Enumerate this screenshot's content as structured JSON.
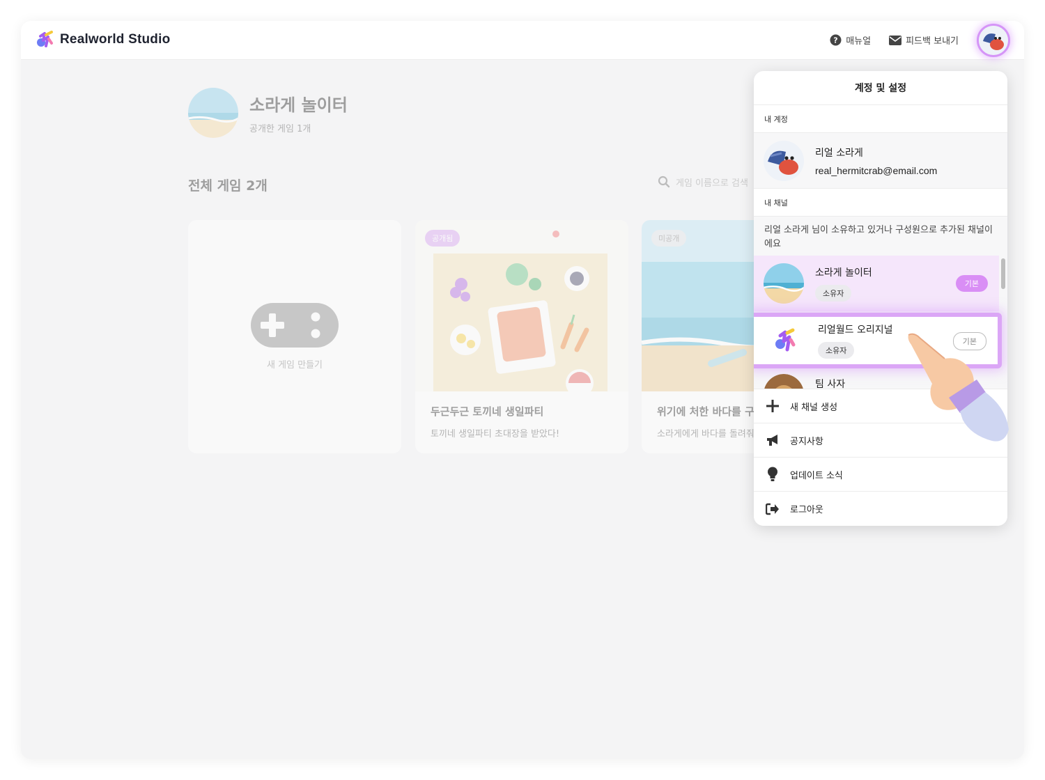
{
  "app": {
    "name": "Realworld Studio"
  },
  "topbar": {
    "manual_label": "매뉴얼",
    "feedback_label": "피드백 보내기"
  },
  "channel": {
    "name": "소라게 놀이터",
    "public_count": "공개한 게임 1개"
  },
  "games_section": {
    "title": "전체 게임 2개",
    "search_placeholder": "게임 이름으로 검색"
  },
  "cards": {
    "new_game_label": "새 게임 만들기",
    "items": [
      {
        "badge": "공개됨",
        "title": "두근두근 토끼네 생일파티",
        "desc": "토끼네 생일파티 초대장을 받았다!"
      },
      {
        "badge": "미공개",
        "title": "위기에 처한 바다를 구해줘",
        "desc": "소라게에게 바다를 돌려줘"
      }
    ]
  },
  "dropdown": {
    "title": "계정 및 설정",
    "my_account_label": "내 계정",
    "account": {
      "name": "리얼 소라게",
      "email": "real_hermitcrab@email.com"
    },
    "my_channels_label": "내 채널",
    "channels_notice": "리얼 소라게 님이 소유하고 있거나 구성원으로 추가된 채널이에요",
    "channels": [
      {
        "name": "소라게 놀이터",
        "role": "소유자",
        "default_label": "기본"
      },
      {
        "name": "리얼월드 오리지널",
        "role": "소유자",
        "default_label": "기본"
      },
      {
        "name": "팀 사자"
      }
    ],
    "menu": [
      {
        "label": "새 채널 생성",
        "icon": "plus-icon"
      },
      {
        "label": "공지사항",
        "icon": "megaphone-icon"
      },
      {
        "label": "업데이트 소식",
        "icon": "lightbulb-icon"
      },
      {
        "label": "로그아웃",
        "icon": "logout-icon"
      }
    ]
  },
  "colors": {
    "accent": "#d98ef5",
    "accent_glow": "#dba6f6",
    "selected_row": "#f5e6fb",
    "background": "#f4f4f5"
  }
}
